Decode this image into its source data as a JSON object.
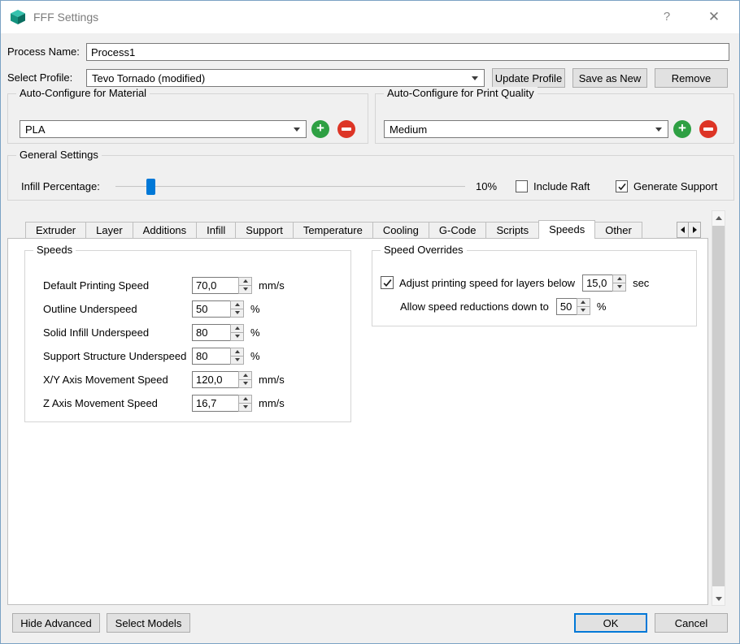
{
  "window": {
    "title": "FFF Settings",
    "help_glyph": "?",
    "close_glyph": "✕"
  },
  "process_name": {
    "label": "Process Name:",
    "value": "Process1"
  },
  "profile": {
    "label": "Select Profile:",
    "selected": "Tevo Tornado (modified)",
    "update_button": "Update Profile",
    "save_as_new_button": "Save as New",
    "remove_button": "Remove"
  },
  "auto_material": {
    "title": "Auto-Configure for Material",
    "selected": "PLA"
  },
  "auto_quality": {
    "title": "Auto-Configure for Print Quality",
    "selected": "Medium"
  },
  "general": {
    "title": "General Settings",
    "infill_label": "Infill Percentage:",
    "infill_percent": 10,
    "infill_value_text": "10%",
    "include_raft_label": "Include Raft",
    "include_raft_checked": false,
    "generate_support_label": "Generate Support",
    "generate_support_checked": true
  },
  "tabs": [
    "Extruder",
    "Layer",
    "Additions",
    "Infill",
    "Support",
    "Temperature",
    "Cooling",
    "G-Code",
    "Scripts",
    "Speeds",
    "Other"
  ],
  "active_tab": "Speeds",
  "speeds": {
    "title": "Speeds",
    "rows": [
      {
        "label": "Default Printing Speed",
        "value": "70,0",
        "unit": "mm/s"
      },
      {
        "label": "Outline Underspeed",
        "value": "50",
        "unit": "%"
      },
      {
        "label": "Solid Infill Underspeed",
        "value": "80",
        "unit": "%"
      },
      {
        "label": "Support Structure Underspeed",
        "value": "80",
        "unit": "%"
      },
      {
        "label": "X/Y Axis Movement Speed",
        "value": "120,0",
        "unit": "mm/s"
      },
      {
        "label": "Z Axis Movement Speed",
        "value": "16,7",
        "unit": "mm/s"
      }
    ]
  },
  "speed_overrides": {
    "title": "Speed Overrides",
    "adjust_checked": true,
    "adjust_label": "Adjust printing speed for layers below",
    "adjust_value": "15,0",
    "adjust_unit": "sec",
    "reduce_label": "Allow speed reductions down to",
    "reduce_value": "50",
    "reduce_unit": "%"
  },
  "footer": {
    "hide_advanced": "Hide Advanced",
    "select_models": "Select Models",
    "ok": "OK",
    "cancel": "Cancel"
  }
}
